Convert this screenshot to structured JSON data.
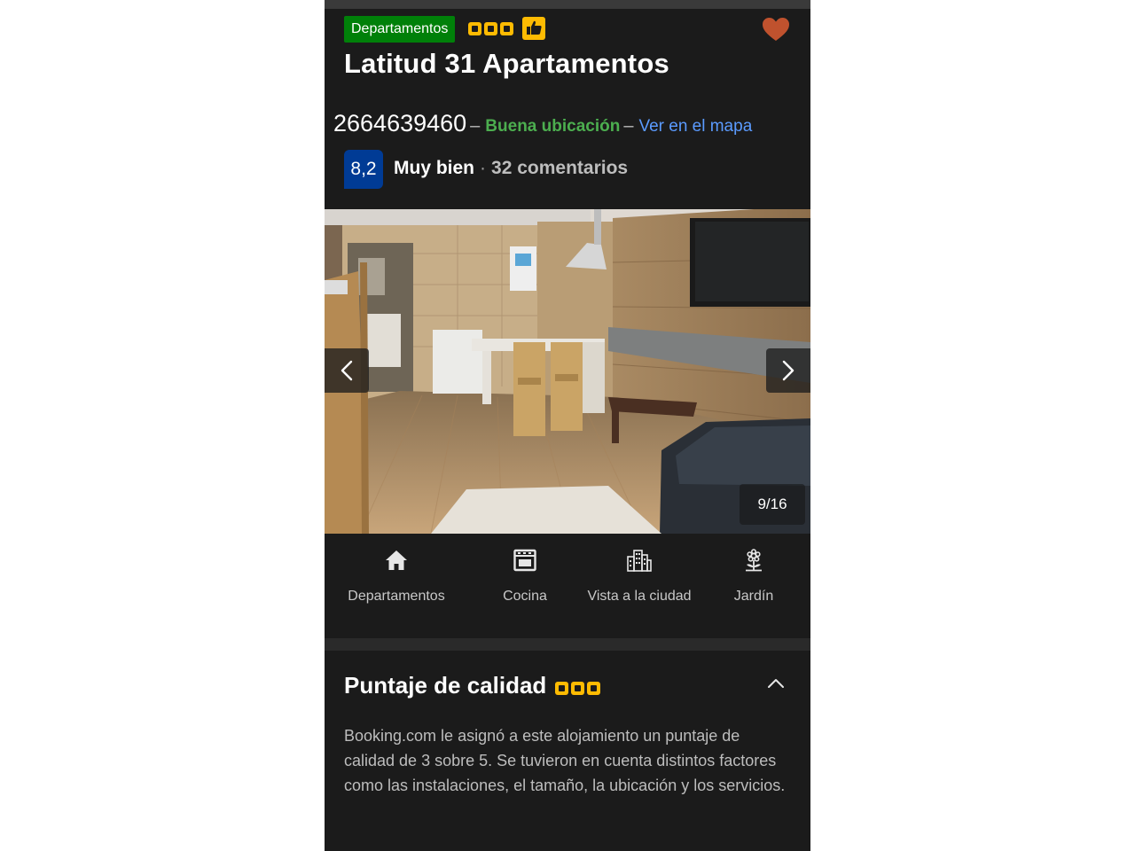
{
  "property": {
    "badge": "Departamentos",
    "name": "Latitud 31 Apartamentos",
    "phone": "2664639460",
    "location_label": "Buena ubicación",
    "map_link": "Ver en el mapa",
    "stars": 3,
    "favorite": true
  },
  "review": {
    "score": "8,2",
    "label": "Muy bien",
    "separator": "·",
    "count_text": "32 comentarios"
  },
  "gallery": {
    "counter": "9/16",
    "current": 9,
    "total": 16
  },
  "facilities": [
    {
      "label": "Departamentos",
      "icon": "house-icon"
    },
    {
      "label": "Cocina",
      "icon": "stove-icon"
    },
    {
      "label": "Vista a la ciudad",
      "icon": "city-icon"
    },
    {
      "label": "Jardín",
      "icon": "flower-icon"
    }
  ],
  "quality": {
    "title": "Puntaje de calidad",
    "stars": 3,
    "description": "Booking.com le asignó a este alojamiento un puntaje de calidad de 3 sobre 5. Se tuvieron en cuenta distintos factores como las instalaciones, el tamaño, la ubicación y los servicios."
  },
  "colors": {
    "background": "#1b1b1b",
    "badge_green": "#008009",
    "star_yellow": "#febb02",
    "score_blue": "#003b95",
    "location_green": "#4cae4f",
    "link_blue": "#5b9bff",
    "heart": "#c0522e"
  }
}
